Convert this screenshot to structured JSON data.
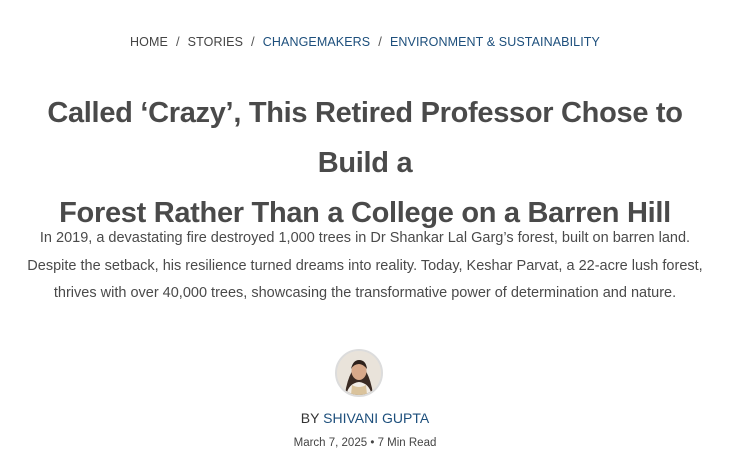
{
  "breadcrumb": {
    "items": [
      {
        "label": "HOME"
      },
      {
        "label": "STORIES"
      },
      {
        "label": "CHANGEMAKERS"
      },
      {
        "label": "ENVIRONMENT & SUSTAINABILITY"
      }
    ],
    "separator": "/"
  },
  "article": {
    "title_line1": "Called ‘Crazy’, This Retired Professor Chose to Build a",
    "title_line2": "Forest Rather Than a College on a Barren Hill",
    "summary_line1": "In 2019, a devastating fire destroyed 1,000 trees in Dr Shankar Lal Garg’s forest, built on barren land.",
    "summary_line2": "Despite the setback, his resilience turned dreams into reality. Today, Keshar Parvat, a 22-acre lush forest,",
    "summary_line3": "thrives with over 40,000 trees, showcasing the transformative power of determination and nature.",
    "by_label": "BY",
    "author": "SHIVANI GUPTA",
    "date": "March 7, 2025",
    "meta_separator": "•",
    "read_time": "7 Min Read"
  },
  "colors": {
    "accent": "#1d4f7c",
    "text": "#4a4a4a"
  }
}
